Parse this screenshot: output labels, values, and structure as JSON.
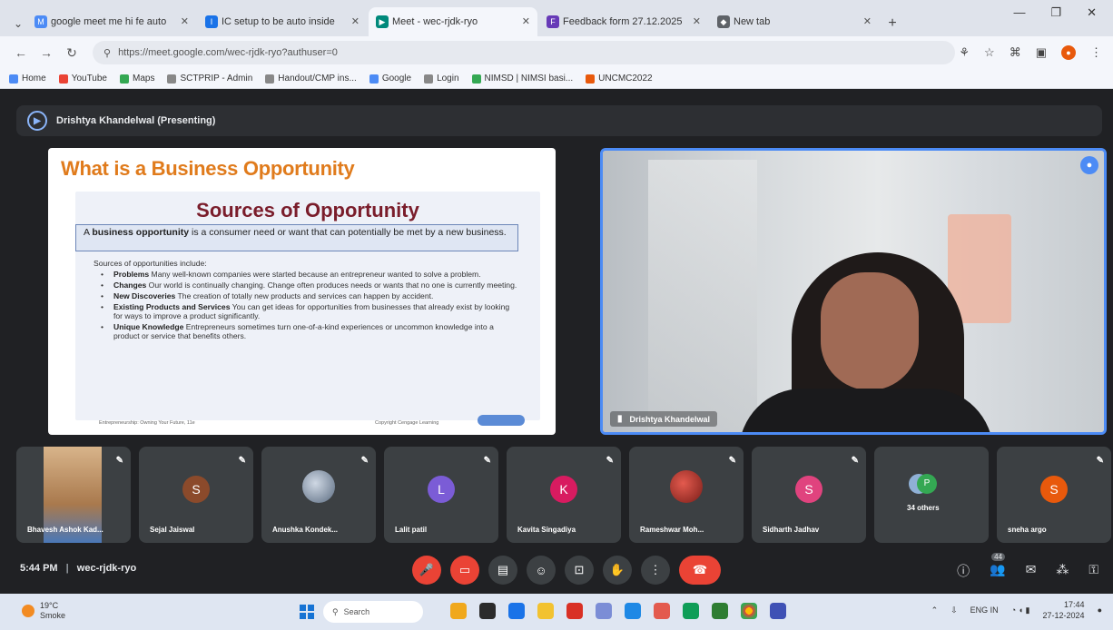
{
  "browser": {
    "tabs": [
      {
        "label": "google meet me hi fe auto",
        "active": false
      },
      {
        "label": "IC setup to be auto inside",
        "active": false
      },
      {
        "label": "Meet - wec-rjdk-ryo",
        "active": true
      },
      {
        "label": "Feedback form 27.12.2025",
        "active": false
      },
      {
        "label": "New tab",
        "active": false
      }
    ],
    "url": "https://meet.google.com/wec-rjdk-ryo?authuser=0",
    "bookmarks": [
      {
        "label": "Home",
        "color": "#4c8bf5"
      },
      {
        "label": "YouTube",
        "color": "#ea4335"
      },
      {
        "label": "Maps",
        "color": "#34a853"
      },
      {
        "label": "SCTPRIP - Admin",
        "color": "#888888"
      },
      {
        "label": "Handout/CMP ins...",
        "color": "#888888"
      },
      {
        "label": "Google",
        "color": "#4c8bf5"
      },
      {
        "label": "Login",
        "color": "#888888"
      },
      {
        "label": "NIMSD | NIMSI basi...",
        "color": "#34a853"
      },
      {
        "label": "UNCMC2022",
        "color": "#e8590c"
      }
    ]
  },
  "meet": {
    "presenter_bar": "Drishtya Khandelwal (Presenting)",
    "slide": {
      "title": "What is a Business Opportunity",
      "subtitle": "Sources of Opportunity",
      "box_bold": "business opportunity",
      "box_pre": "A ",
      "box_post": " is a consumer need or want that can potentially be met by a new business.",
      "intro": "Sources of opportunities include:",
      "bullets": [
        {
          "head": "Problems",
          "text": " Many well-known companies were started because an entrepreneur wanted to solve a problem."
        },
        {
          "head": "Changes",
          "text": " Our world is continually changing. Change often produces needs or wants that no one is currently meeting."
        },
        {
          "head": "New Discoveries",
          "text": " The creation of totally new products and services can happen by accident."
        },
        {
          "head": "Existing Products and Services",
          "text": " You can get ideas for opportunities from businesses that already exist by looking for ways to improve a product significantly."
        },
        {
          "head": "Unique Knowledge",
          "text": " Entrepreneurs sometimes turn one-of-a-kind experiences or uncommon knowledge into a product or service that benefits others."
        }
      ],
      "footer_left": "Entrepreneurship: Owning Your Future, 11e",
      "footer_right": "Copyright Cengage Learning"
    },
    "speaker_name": "Drishtya Khandelwal",
    "participants": [
      {
        "name": "Bhavesh Ashok Kad...",
        "initial": "",
        "color": "#b58a5a",
        "photo": true
      },
      {
        "name": "Sejal Jaiswal",
        "initial": "S",
        "color": "#8b4a2b"
      },
      {
        "name": "Anushka Kondek...",
        "initial": "",
        "color": "#5a6b80",
        "photo": true
      },
      {
        "name": "Lalit patil",
        "initial": "L",
        "color": "#7b5cd6"
      },
      {
        "name": "Kavita Singadiya",
        "initial": "K",
        "color": "#d81b60"
      },
      {
        "name": "Rameshwar Moh...",
        "initial": "",
        "color": "#b3261e",
        "photo": true
      },
      {
        "name": "Sidharth Jadhav",
        "initial": "S",
        "color": "#e0437e"
      },
      {
        "name": "34 others",
        "initial": "P",
        "color": "#34a853"
      },
      {
        "name": "sneha argo",
        "initial": "S",
        "color": "#e8590c"
      }
    ],
    "time": "5:44 PM",
    "meeting_code": "wec-rjdk-ryo",
    "participant_count": "44"
  },
  "taskbar": {
    "weather_temp": "19°C",
    "weather_desc": "Smoke",
    "search": "Search",
    "lang": "ENG IN",
    "clock_time": "17:44",
    "clock_date": "27-12-2024"
  }
}
